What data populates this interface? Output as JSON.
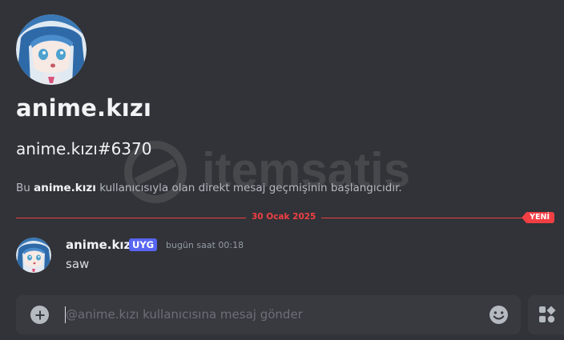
{
  "profile": {
    "display_name": "anime.kızı",
    "username": "anime.kızı#6370",
    "intro_prefix": "Bu ",
    "intro_name": "anime.kızı",
    "intro_suffix": " kullanıcısıyla olan direkt mesaj geçmişinin başlangıcıdır."
  },
  "divider": {
    "date": "30 Ocak 2025",
    "new_label": "YENİ",
    "color": "#f23f43"
  },
  "message": {
    "author": "anime.kızı",
    "tag": "UYG",
    "timestamp": "bugün saat 00:18",
    "text": "saw"
  },
  "composer": {
    "placeholder": "@anime.kızı kullanıcısına mesaj gönder",
    "value": ""
  },
  "watermark": {
    "text": "itemsatis"
  },
  "icons": {
    "attach": "plus-circle-icon",
    "emoji": "emoji-icon",
    "apps": "apps-icon"
  },
  "colors": {
    "background": "#313338",
    "composer": "#383a40",
    "accent": "#5865f2",
    "new_marker": "#f23f43"
  }
}
